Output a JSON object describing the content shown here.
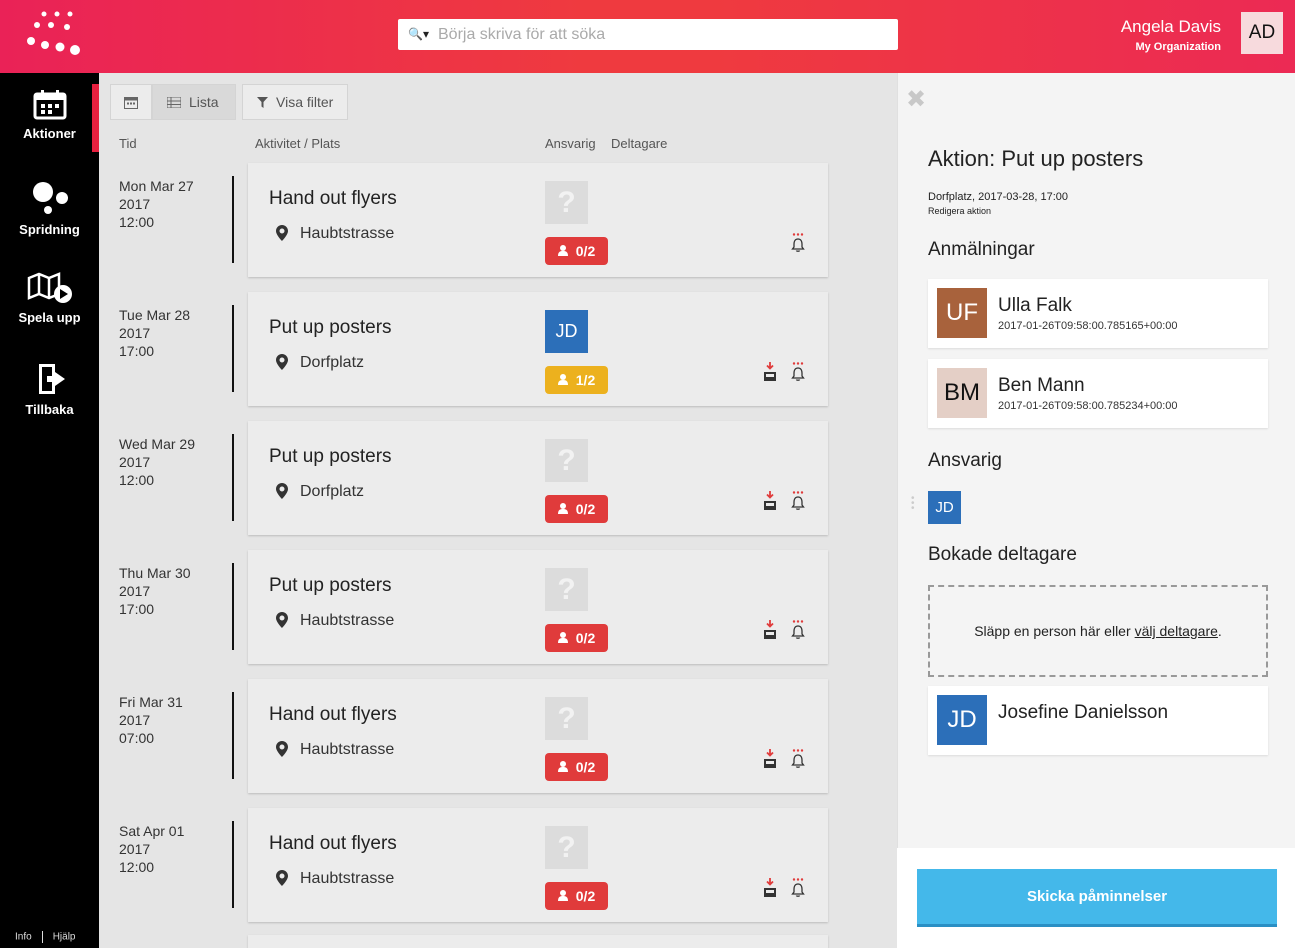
{
  "search": {
    "placeholder": "Börja skriva för att söka"
  },
  "user": {
    "name": "Angela Davis",
    "org": "My Organization",
    "initials": "AD"
  },
  "sidebar": {
    "items": [
      {
        "label": "Aktioner"
      },
      {
        "label": "Spridning"
      },
      {
        "label": "Spela upp"
      },
      {
        "label": "Tillbaka"
      }
    ],
    "footer": {
      "info": "Info",
      "help": "Hjälp"
    }
  },
  "toolbar": {
    "list_label": "Lista",
    "filter_label": "Visa filter"
  },
  "columns": {
    "time": "Tid",
    "activity": "Aktivitet / Plats",
    "responsible": "Ansvarig",
    "participants": "Deltagare"
  },
  "actions": [
    {
      "day": "Mon Mar 27",
      "year": "2017",
      "time": "12:00",
      "title": "Hand out flyers",
      "place": "Haubtstrasse",
      "responsible": "?",
      "count": "0/2"
    },
    {
      "day": "Tue Mar 28",
      "year": "2017",
      "time": "17:00",
      "title": "Put up posters",
      "place": "Dorfplatz",
      "responsible": "JD",
      "count": "1/2"
    },
    {
      "day": "Wed Mar 29",
      "year": "2017",
      "time": "12:00",
      "title": "Put up posters",
      "place": "Dorfplatz",
      "responsible": "?",
      "count": "0/2"
    },
    {
      "day": "Thu Mar 30",
      "year": "2017",
      "time": "17:00",
      "title": "Put up posters",
      "place": "Haubtstrasse",
      "responsible": "?",
      "count": "0/2"
    },
    {
      "day": "Fri Mar 31",
      "year": "2017",
      "time": "07:00",
      "title": "Hand out flyers",
      "place": "Haubtstrasse",
      "responsible": "?",
      "count": "0/2"
    },
    {
      "day": "Sat Apr 01",
      "year": "2017",
      "time": "12:00",
      "title": "Hand out flyers",
      "place": "Haubtstrasse",
      "responsible": "?",
      "count": "0/2"
    }
  ],
  "panel": {
    "title": "Aktion: Put up posters",
    "meta": "Dorfplatz, 2017-03-28, 17:00",
    "edit": "Redigera aktion",
    "signups_heading": "Anmälningar",
    "signups": [
      {
        "initials": "UF",
        "name": "Ulla Falk",
        "date": "2017-01-26T09:58:00.785165+00:00",
        "color": "#a8623c"
      },
      {
        "initials": "BM",
        "name": "Ben Mann",
        "date": "2017-01-26T09:58:00.785234+00:00",
        "color": "#e4cfc6"
      }
    ],
    "responsible_heading": "Ansvarig",
    "responsible_initials": "JD",
    "booked_heading": "Bokade deltagare",
    "dropzone_text": "Släpp en person här eller",
    "dropzone_link": "välj deltagare",
    "dropzone_end": ".",
    "booked": [
      {
        "initials": "JD",
        "name": "Josefine Danielsson",
        "color": "#2c6fb9"
      }
    ],
    "send_label": "Skicka påminnelser"
  },
  "colors": {
    "accent": "#ef3a3f",
    "badge_red": "#e03b3b",
    "badge_yellow": "#ecb11e",
    "button_blue": "#44b8ea"
  }
}
